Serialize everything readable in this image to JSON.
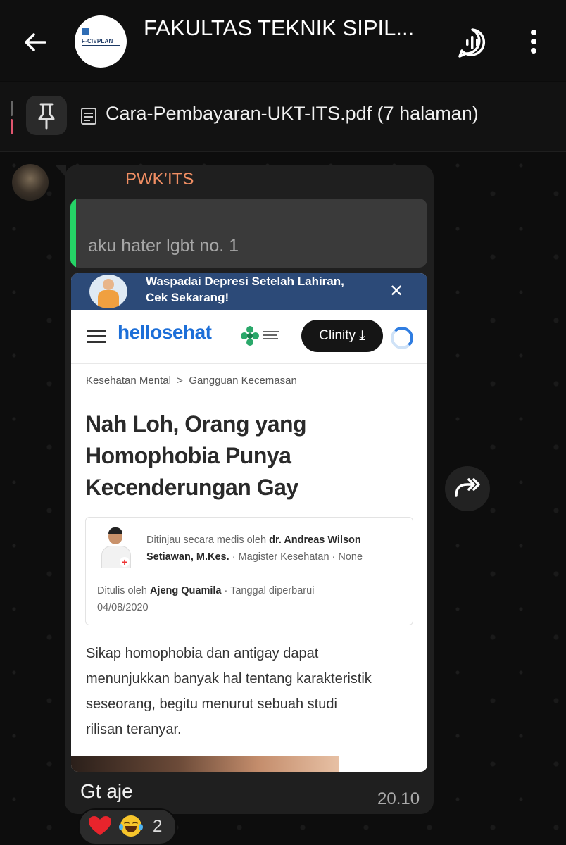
{
  "header": {
    "title": "FAKULTAS TEKNIK SIPIL...",
    "avatar_logo_text": "F-CIVPLAN",
    "icons": [
      "back-arrow-icon",
      "voice-chat-icon",
      "more-vert-icon"
    ]
  },
  "pinned": {
    "text": "Cara-Pembayaran-UKT-ITS.pdf (7 halaman)",
    "icons": [
      "pin-icon",
      "document-icon"
    ]
  },
  "message": {
    "sender": "PWK’ITS",
    "quoted_text": "aku hater lgbt no. 1",
    "caption": "Gt aje",
    "time": "20.10",
    "reactions": {
      "emojis": [
        "red-heart",
        "face-with-tears-of-joy"
      ],
      "count": "2"
    },
    "colors": {
      "sender": "#f08e63",
      "quote_bar": "#25d366",
      "bubble": "#1f1f1f"
    }
  },
  "screenshot": {
    "banner_line1": "Waspadai Depresi Setelah Lahiran,",
    "banner_line2": "Cek Sekarang!",
    "brand": "hellosehat",
    "clinity": "Clinity",
    "breadcrumb_1": "Kesehatan Mental",
    "breadcrumb_sep": ">",
    "breadcrumb_2": "Gangguan Kecemasan",
    "headline_1": "Nah Loh, Orang yang",
    "headline_2": "Homophobia Punya",
    "headline_3": "Kecenderungan Gay",
    "review_prefix": "Ditinjau secara medis oleh",
    "reviewer_a": "dr. Andreas Wilson",
    "reviewer_b": "Setiawan, M.Kes.",
    "reviewer_suffix": "· Magister Kesehatan · None",
    "written_prefix": "Ditulis oleh",
    "author": "Ajeng Quamila",
    "updated_label": "· Tanggal diperbarui",
    "updated_date": "04/08/2020",
    "article_1": "Sikap homophobia dan antigay dapat",
    "article_2": "menunjukkan banyak hal tentang karakteristik",
    "article_3": "seseorang, begitu menurut sebuah studi",
    "article_4": "rilisan teranyar."
  }
}
